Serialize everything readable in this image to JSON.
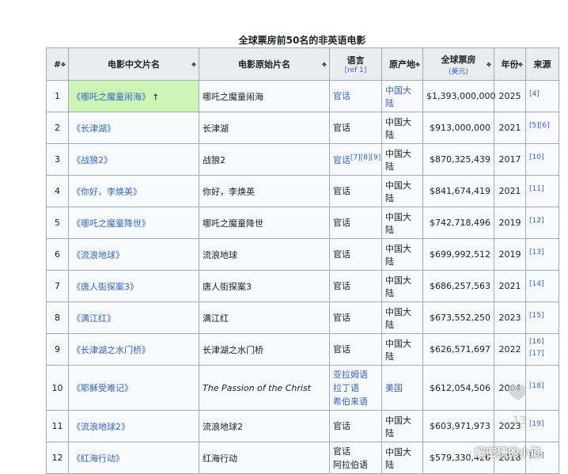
{
  "caption": "全球票房前50名的非英语电影",
  "headers": {
    "rank": "#",
    "cn_title": "电影中文片名",
    "orig_title": "电影原始片名",
    "language": "语言",
    "language_ref": "[ref 1]",
    "country": "原产地",
    "gross": "全球票房",
    "gross_unit": "(美元)",
    "year": "年份",
    "source": "来源"
  },
  "rows": [
    {
      "rank": "1",
      "cn": "《哪吒之魔童闹海》",
      "dagger": "†",
      "orig": "哪吒之魔童闹海",
      "lang": [
        "官话"
      ],
      "country": "中国大陆",
      "gross": "$1,393,000,000",
      "year": "2025",
      "ref": "[4]",
      "highlight": true
    },
    {
      "rank": "2",
      "cn": "《长津湖》",
      "orig": "长津湖",
      "lang": [
        "官话"
      ],
      "country": "中国大陆",
      "gross": "$913,000,000",
      "year": "2021",
      "ref": "[5][6]"
    },
    {
      "rank": "3",
      "cn": "《战狼2》",
      "orig": "战狼2",
      "lang": [
        "官话"
      ],
      "lang_ref": "[7][8][9]",
      "country": "中国大陆",
      "gross": "$870,325,439",
      "year": "2017",
      "ref": "[10]"
    },
    {
      "rank": "4",
      "cn": "《你好，李焕英》",
      "orig": "你好，李焕英",
      "lang": [
        "官话"
      ],
      "country": "中国大陆",
      "gross": "$841,674,419",
      "year": "2021",
      "ref": "[11]"
    },
    {
      "rank": "5",
      "cn": "《哪吒之魔童降世》",
      "orig": "哪吒之魔童降世",
      "lang": [
        "官话"
      ],
      "country": "中国大陆",
      "gross": "$742,718,496",
      "year": "2019",
      "ref": "[12]"
    },
    {
      "rank": "6",
      "cn": "《流浪地球》",
      "orig": "流浪地球",
      "lang": [
        "官话"
      ],
      "country": "中国大陆",
      "gross": "$699,992,512",
      "year": "2019",
      "ref": "[13]"
    },
    {
      "rank": "7",
      "cn": "《唐人街探案3》",
      "orig": "唐人街探案3",
      "lang": [
        "官话"
      ],
      "country": "中国大陆",
      "gross": "$686,257,563",
      "year": "2021",
      "ref": "[14]"
    },
    {
      "rank": "8",
      "cn": "《满江红》",
      "orig": "满江红",
      "lang": [
        "官话"
      ],
      "country": "中国大陆",
      "gross": "$673,552,250",
      "year": "2023",
      "ref": "[15]"
    },
    {
      "rank": "9",
      "cn": "《长津湖之水门桥》",
      "orig": "长津湖之水门桥",
      "lang": [
        "官话"
      ],
      "country": "中国大陆",
      "gross": "$626,571,697",
      "year": "2022",
      "ref": "[16][17]"
    },
    {
      "rank": "10",
      "cn": "《耶稣受难记》",
      "orig": "The Passion of the Christ",
      "orig_italic": true,
      "lang": [
        "亚拉姆语",
        "拉丁语",
        "希伯来语"
      ],
      "lang_link": true,
      "country": "美国",
      "country_link": true,
      "gross": "$612,054,506",
      "year": "2004",
      "ref": "[18]",
      "tall": true
    },
    {
      "rank": "11",
      "cn": "《流浪地球2》",
      "orig": "流浪地球2",
      "lang": [
        "官话"
      ],
      "country": "中国大陆",
      "gross": "$603,971,973",
      "year": "2023",
      "ref": "[19]"
    },
    {
      "rank": "12",
      "cn": "《红海行动》",
      "orig": "红海行动",
      "lang": [
        "官话",
        "阿拉伯语"
      ],
      "country": "中国大陆",
      "gross": "$579,330,426",
      "year": "2018",
      "ref": "[20]"
    }
  ],
  "watermark": {
    "count": "13",
    "text": "解密猜的小道"
  },
  "colors": {
    "link": "#3366cc",
    "highlight": "#ccf5b5",
    "header_bg": "#eaecf0",
    "border": "#a2a9b1"
  }
}
